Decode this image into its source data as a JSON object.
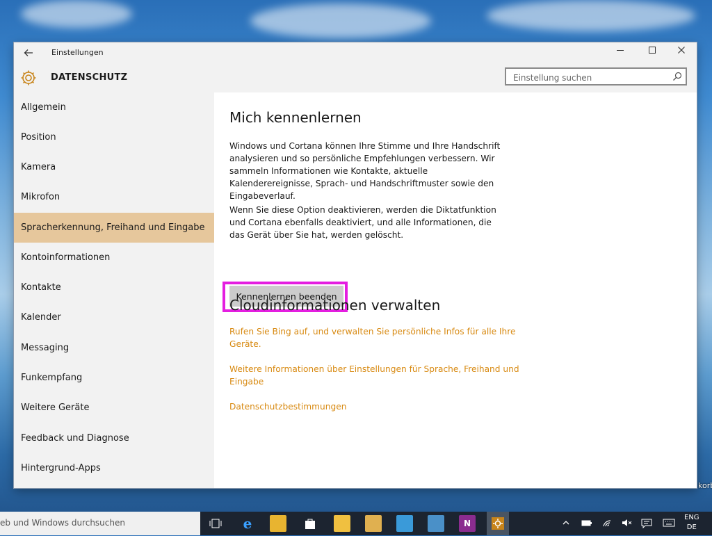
{
  "window": {
    "title": "Einstellungen",
    "section": "DATENSCHUTZ"
  },
  "search": {
    "placeholder": "Einstellung suchen"
  },
  "sidebar": {
    "items": [
      {
        "label": "Allgemein",
        "active": false
      },
      {
        "label": "Position",
        "active": false
      },
      {
        "label": "Kamera",
        "active": false
      },
      {
        "label": "Mikrofon",
        "active": false
      },
      {
        "label": "Spracherkennung, Freihand und Eingabe",
        "active": true
      },
      {
        "label": "Kontoinformationen",
        "active": false
      },
      {
        "label": "Kontakte",
        "active": false
      },
      {
        "label": "Kalender",
        "active": false
      },
      {
        "label": "Messaging",
        "active": false
      },
      {
        "label": "Funkempfang",
        "active": false
      },
      {
        "label": "Weitere Geräte",
        "active": false
      },
      {
        "label": "Feedback und Diagnose",
        "active": false
      },
      {
        "label": "Hintergrund-Apps",
        "active": false
      }
    ]
  },
  "content": {
    "heading1": "Mich kennenlernen",
    "para1": "Windows und Cortana können Ihre Stimme und Ihre Handschrift analysieren und so persönliche Empfehlungen verbessern. Wir sammeln Informationen wie Kontakte, aktuelle Kalenderereignisse, Sprach- und Handschriftmuster sowie den Eingabeverlauf.",
    "para2": "Wenn Sie diese Option deaktivieren, werden die Diktatfunktion und Cortana ebenfalls deaktiviert, und alle Informationen, die das Gerät über Sie hat, werden gelöscht.",
    "button": "Kennenlernen beenden",
    "heading2": "Cloudinformationen verwalten",
    "links": [
      "Rufen Sie Bing auf, und verwalten Sie persönliche Infos für alle Ihre Geräte.",
      "Weitere Informationen über Einstellungen für Sprache, Freihand und Eingabe",
      "Datenschutzbestimmungen"
    ]
  },
  "taskbar": {
    "search_text": "eb und Windows durchsuchen",
    "lang_top": "ENG",
    "lang_bottom": "DE"
  },
  "desktop": {
    "label": "korb"
  },
  "colors": {
    "accent": "#d88a12",
    "active_item": "#e6c79c",
    "highlight_frame": "#e41ee0"
  }
}
